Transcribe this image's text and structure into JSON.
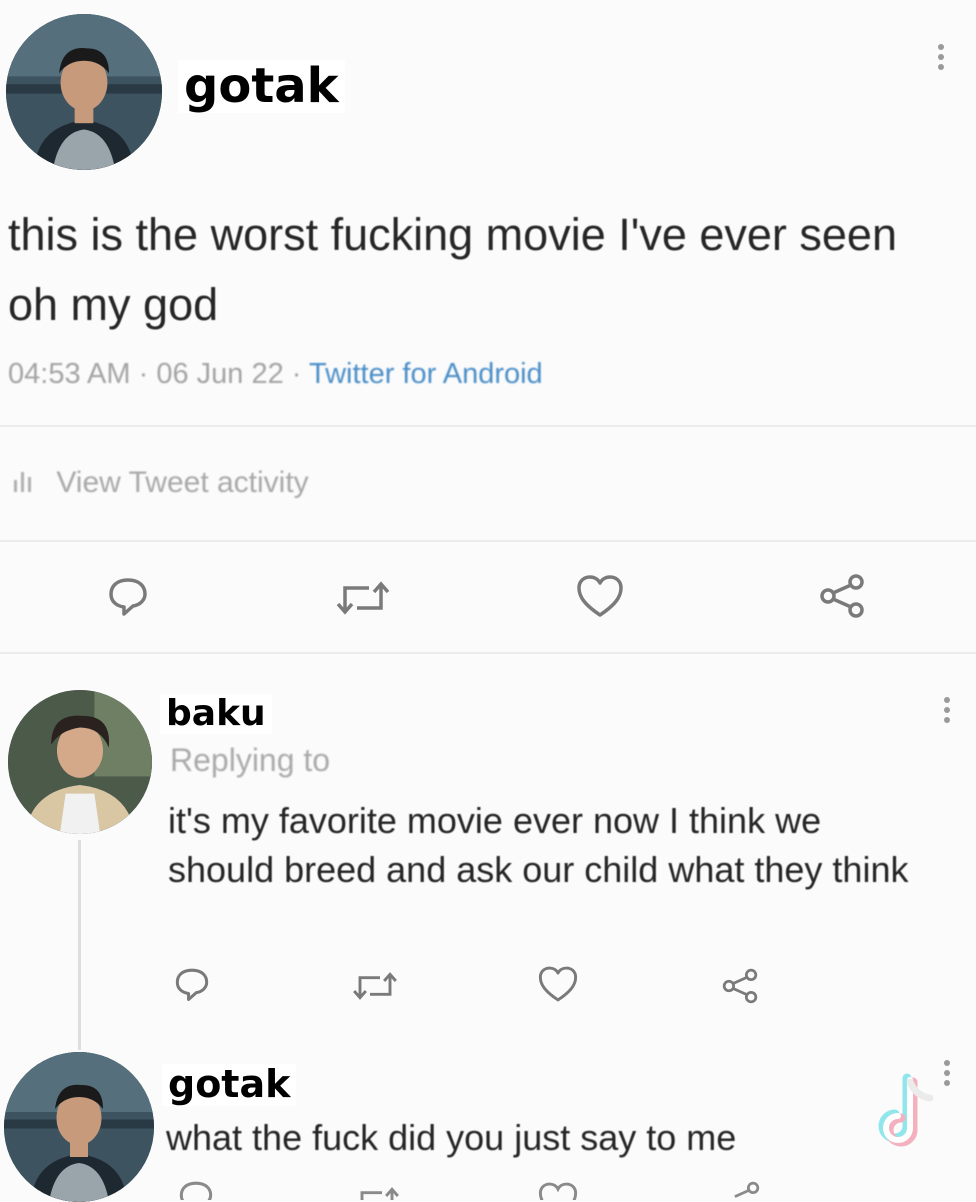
{
  "colors": {
    "accent": "#4a8ec8",
    "icon_gray": "#7a7a7a",
    "background": "#fbfbfb"
  },
  "main_tweet": {
    "author": "gotak",
    "text": "this is the worst fucking movie I've ever seen oh my god",
    "time": "04:53 AM",
    "date": "06 Jun 22",
    "source": "Twitter for Android",
    "activity_label": "View Tweet activity",
    "actions": [
      "reply-icon",
      "retweet-icon",
      "like-icon",
      "share-icon"
    ]
  },
  "reply_1": {
    "author": "baku",
    "replying_to": "Replying to",
    "text": "it's my favorite movie ever now I think we should breed and ask our child what they think",
    "actions": [
      "reply-icon",
      "retweet-icon",
      "like-icon",
      "share-icon"
    ]
  },
  "reply_2": {
    "author": "gotak",
    "text": "what the fuck did you just say to me"
  },
  "watermark": {
    "icon": "tiktok-logo-icon"
  }
}
